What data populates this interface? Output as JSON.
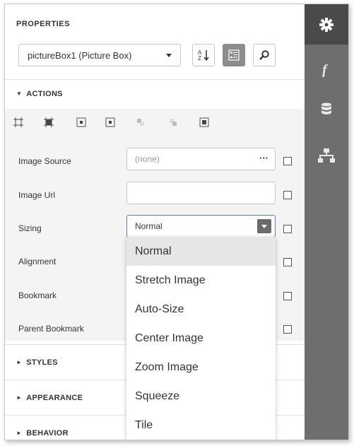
{
  "panel": {
    "title": "PROPERTIES",
    "selector_value": "pictureBox1 (Picture Box)"
  },
  "toolbar": {
    "sort_icon": "sort-alpha-icon",
    "categories_icon": "categorized-icon",
    "search_icon": "search-icon"
  },
  "rail": {
    "items": [
      "gear-icon",
      "function-icon",
      "database-icon",
      "hierarchy-icon"
    ]
  },
  "sections": {
    "actions": "ACTIONS",
    "styles": "STYLES",
    "appearance": "APPEARANCE",
    "behavior": "BEHAVIOR"
  },
  "properties": [
    {
      "label": "Image Source",
      "value": "(none)",
      "ellipsis": "···"
    },
    {
      "label": "Image Url",
      "value": ""
    },
    {
      "label": "Sizing",
      "value": "Normal"
    },
    {
      "label": "Alignment",
      "value": ""
    },
    {
      "label": "Bookmark",
      "value": ""
    },
    {
      "label": "Parent Bookmark",
      "value": ""
    }
  ],
  "sizing_menu": {
    "selected": "Normal",
    "options": [
      "Normal",
      "Stretch Image",
      "Auto-Size",
      "Center Image",
      "Zoom Image",
      "Squeeze",
      "Tile"
    ]
  },
  "colors": {
    "rail_bg": "#6e6e6e",
    "rail_active": "#4a4a4a",
    "focus_border": "#5b7fb5"
  }
}
